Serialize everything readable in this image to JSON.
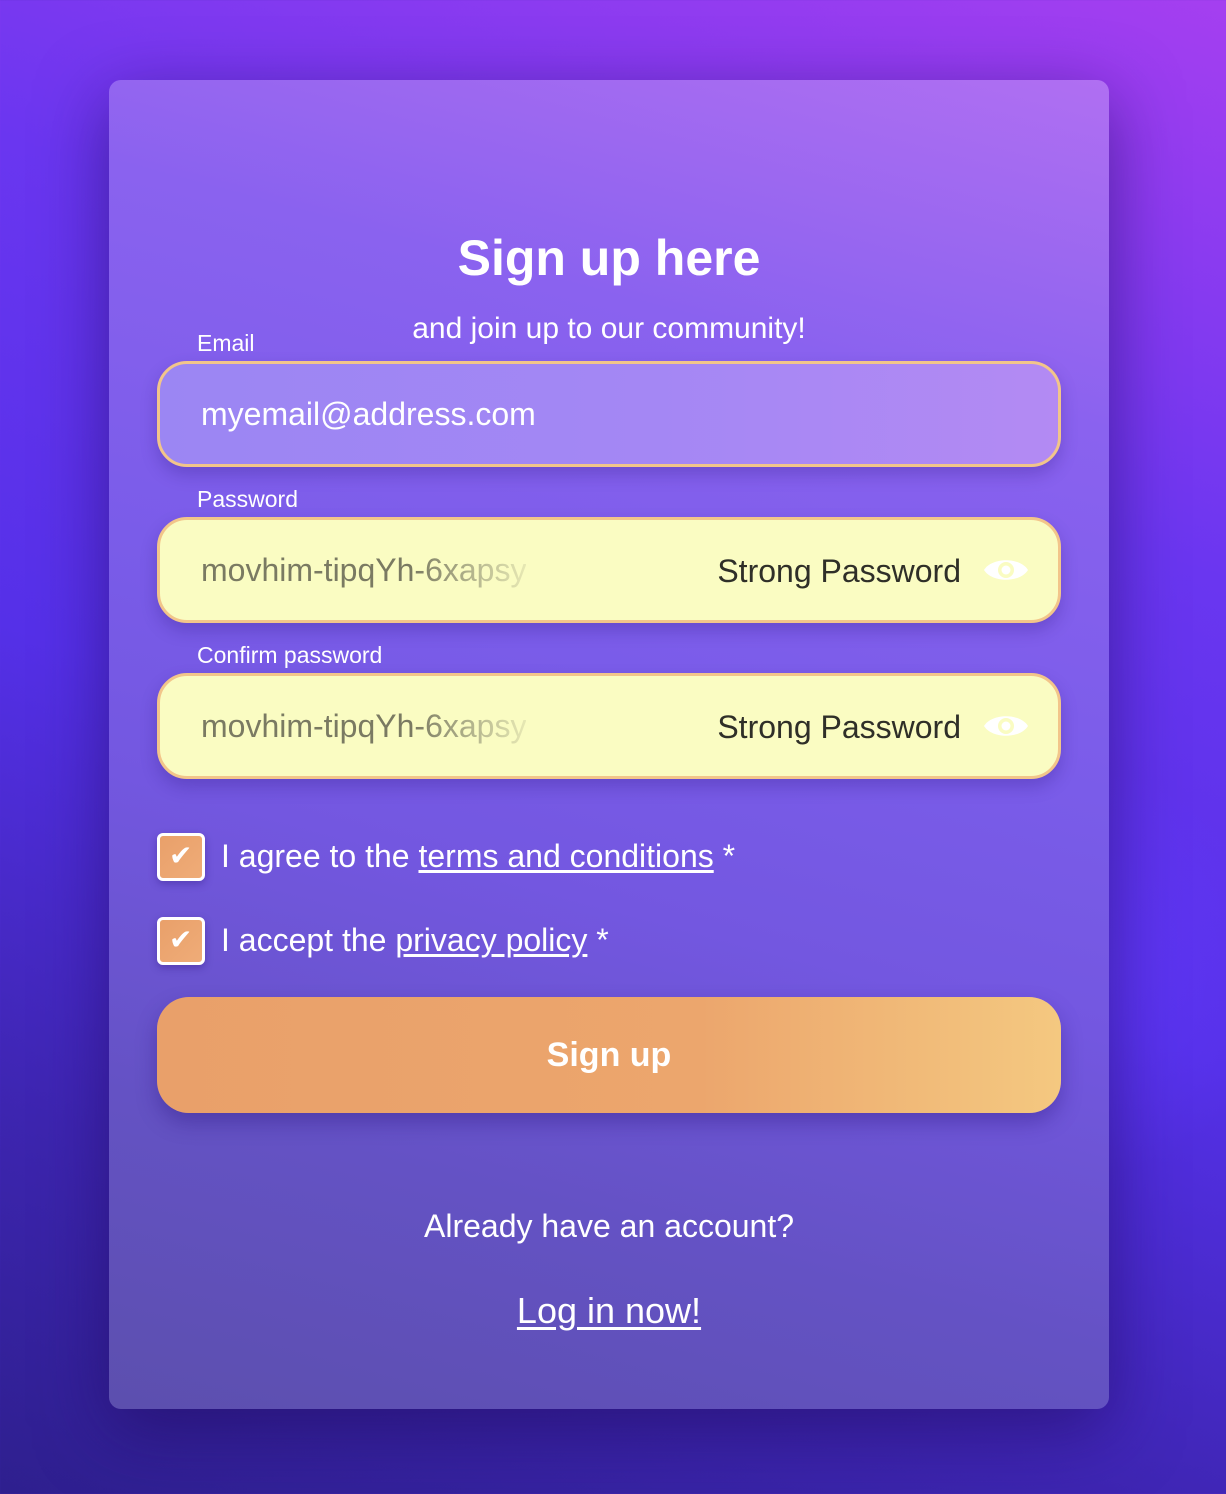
{
  "header": {
    "title": "Sign up here",
    "subtitle": "and join up to our community!"
  },
  "email": {
    "label": "Email",
    "value": "myemail@address.com"
  },
  "password": {
    "label": "Password",
    "value": "movhim-tipqYh-6xapsy",
    "strength": "Strong Password",
    "visibility_icon": "eye-icon"
  },
  "confirm_password": {
    "label": "Confirm password",
    "value": "movhim-tipqYh-6xapsy",
    "strength": "Strong Password",
    "visibility_icon": "eye-icon"
  },
  "checks": {
    "terms": {
      "checked": true,
      "prefix": "I agree to the ",
      "link": "terms and conditions",
      "suffix": " *"
    },
    "privacy": {
      "checked": true,
      "prefix": "I accept the ",
      "link": "privacy policy",
      "suffix": " *"
    },
    "tick_glyph": "✔"
  },
  "submit": {
    "label": "Sign up"
  },
  "footer": {
    "question": "Already have an account?",
    "login_link": "Log in now!"
  },
  "colors": {
    "accent": "#eca66d",
    "field_border": "#f2c58a",
    "password_field_bg": "#fafcc2"
  }
}
